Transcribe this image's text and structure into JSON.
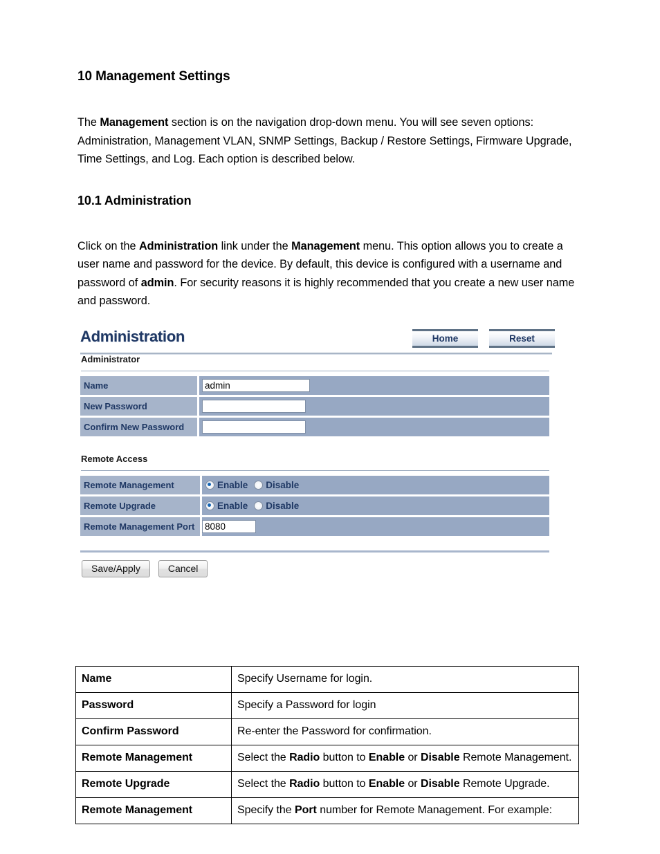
{
  "document": {
    "heading": "10 Management Settings",
    "intro_paragraph": {
      "seg1": "The ",
      "bold1": "Management",
      "seg2": " section is on the navigation drop-down menu. You will see seven options: Administration, Management VLAN, SNMP Settings, Backup / Restore Settings, Firmware Upgrade, Time Settings, and Log. Each option is described below."
    },
    "subheading": "10.1 Administration",
    "admin_paragraph": {
      "seg1": "Click on the ",
      "bold1": "Administration",
      "seg2": " link under the ",
      "bold2": "Management",
      "seg3": " menu. This option allows you to create a user name and password for the device. By default, this device is configured with a username and password of ",
      "bold3": "admin",
      "seg4": ". For security reasons it is highly recommended that you create a new user name and password."
    }
  },
  "screenshot": {
    "title": "Administration",
    "buttons": {
      "home": "Home",
      "reset": "Reset"
    },
    "administrator_section": {
      "label": "Administrator",
      "rows": [
        {
          "label": "Name",
          "value": "admin"
        },
        {
          "label": "New Password",
          "value": ""
        },
        {
          "label": "Confirm New Password",
          "value": ""
        }
      ]
    },
    "remote_access_section": {
      "label": "Remote Access",
      "rows": [
        {
          "label": "Remote Management",
          "enable_label": "Enable",
          "disable_label": "Disable",
          "selected": "Enable"
        },
        {
          "label": "Remote Upgrade",
          "enable_label": "Enable",
          "disable_label": "Disable",
          "selected": "Enable"
        },
        {
          "label": "Remote Management Port",
          "value": "8080"
        }
      ]
    },
    "actions": {
      "save": "Save/Apply",
      "cancel": "Cancel"
    },
    "colors": {
      "title": "#1f3864",
      "row_bg": "#97a8c3",
      "label_bg": "#a6b4ca",
      "radio_selected": "#1464b4"
    }
  },
  "description_table": {
    "rows": [
      {
        "key": "Name",
        "parts": [
          {
            "t": "Specify Username for login.",
            "b": false
          }
        ]
      },
      {
        "key": "Password",
        "parts": [
          {
            "t": "Specify a Password for login",
            "b": false
          }
        ]
      },
      {
        "key": "Confirm Password",
        "parts": [
          {
            "t": "Re-enter the Password for confirmation.",
            "b": false
          }
        ]
      },
      {
        "key": "Remote Management",
        "parts": [
          {
            "t": "Select the ",
            "b": false
          },
          {
            "t": "Radio",
            "b": true
          },
          {
            "t": " button to ",
            "b": false
          },
          {
            "t": "Enable",
            "b": true
          },
          {
            "t": " or ",
            "b": false
          },
          {
            "t": "Disable",
            "b": true
          },
          {
            "t": " Remote Management.",
            "b": false
          }
        ]
      },
      {
        "key": "Remote Upgrade",
        "parts": [
          {
            "t": "Select the ",
            "b": false
          },
          {
            "t": "Radio",
            "b": true
          },
          {
            "t": " button to ",
            "b": false
          },
          {
            "t": "Enable",
            "b": true
          },
          {
            "t": " or ",
            "b": false
          },
          {
            "t": "Disable",
            "b": true
          },
          {
            "t": " Remote Upgrade.",
            "b": false
          }
        ]
      },
      {
        "key": "Remote Management",
        "parts": [
          {
            "t": "Specify the ",
            "b": false
          },
          {
            "t": "Port",
            "b": true
          },
          {
            "t": " number for Remote Management. For example:",
            "b": false
          }
        ]
      }
    ]
  }
}
